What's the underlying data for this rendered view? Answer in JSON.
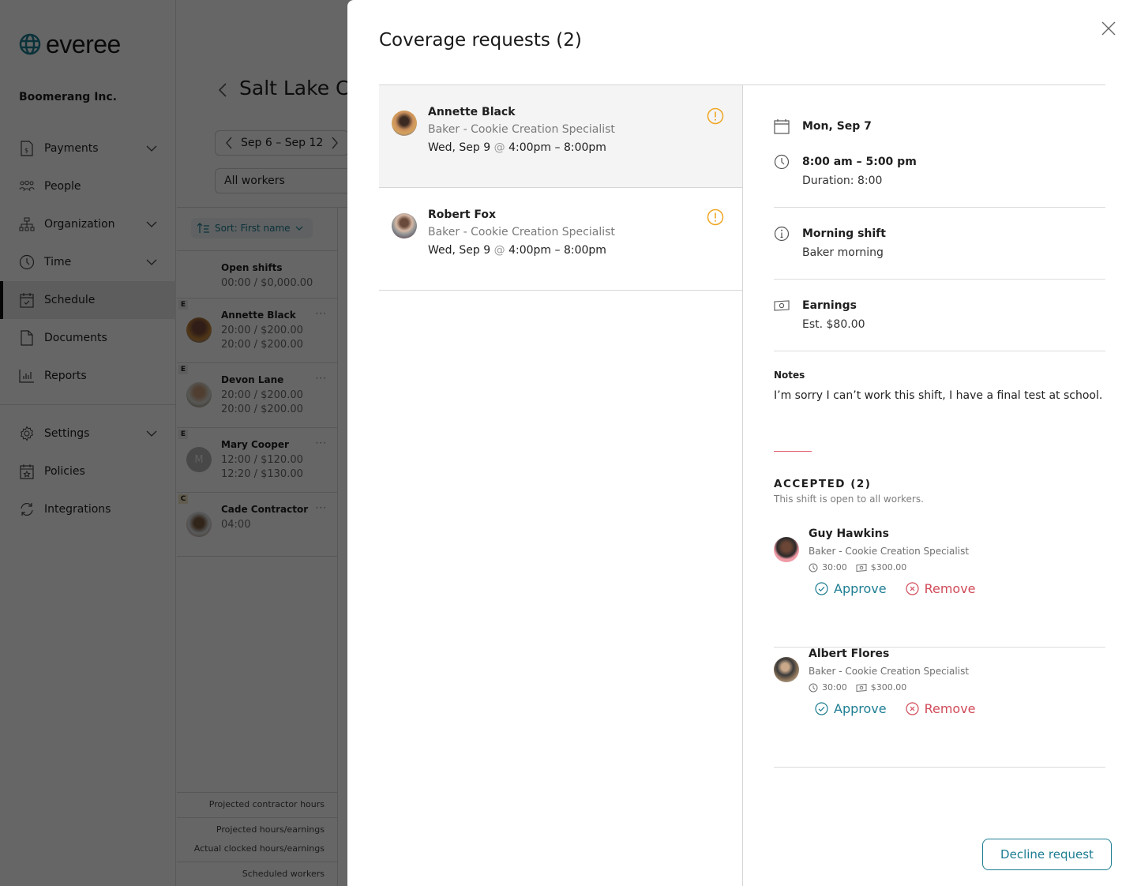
{
  "app": {
    "brand": "everee",
    "company": "Boomerang Inc.",
    "nav": [
      {
        "label": "Payments",
        "icon": "payments-icon",
        "expandable": true
      },
      {
        "label": "People",
        "icon": "people-icon",
        "expandable": false
      },
      {
        "label": "Organization",
        "icon": "organization-icon",
        "expandable": true
      },
      {
        "label": "Time",
        "icon": "clock-icon",
        "expandable": true
      },
      {
        "label": "Schedule",
        "icon": "calendar-check-icon",
        "expandable": false,
        "active": true
      },
      {
        "label": "Documents",
        "icon": "document-icon",
        "expandable": false
      },
      {
        "label": "Reports",
        "icon": "bar-chart-icon",
        "expandable": false
      }
    ],
    "nav_secondary": [
      {
        "label": "Settings",
        "icon": "gear-icon",
        "expandable": true
      },
      {
        "label": "Policies",
        "icon": "calendar-star-icon",
        "expandable": false
      },
      {
        "label": "Integrations",
        "icon": "sync-icon",
        "expandable": false
      }
    ],
    "page_title": "Salt Lake City",
    "date_range": "Sep 6 – Sep 12",
    "worker_filter": "All workers",
    "sort_label": "Sort: First name",
    "open_shifts": {
      "label": "Open shifts",
      "value": "00:00 / $0,000.00"
    },
    "schedule_rows": [
      {
        "type": "E",
        "name": "Annette Black",
        "lines": [
          "20:00 / $200.00",
          "20:00 / $200.00"
        ]
      },
      {
        "type": "E",
        "name": "Devon Lane",
        "lines": [
          "20:00 / $200.00",
          "20:00 / $200.00"
        ]
      },
      {
        "type": "E",
        "name": "Mary Cooper",
        "initial": "M",
        "lines": [
          "12:00 / $120.00",
          "12:20 / $130.00"
        ]
      },
      {
        "type": "C",
        "name": "Cade Contractor",
        "lines": [
          "04:00"
        ]
      }
    ],
    "footer_labels": {
      "contractor_hours": "Projected contractor hours",
      "projected": "Projected hours/earnings",
      "actual": "Actual clocked hours/earnings",
      "scheduled": "Scheduled workers"
    }
  },
  "modal": {
    "title": "Coverage requests (2)",
    "requests": [
      {
        "name": "Annette Black",
        "role": "Baker - Cookie Creation Specialist",
        "day": "Wed, Sep 9",
        "at": "@",
        "time": "4:00pm – 8:00pm",
        "selected": true
      },
      {
        "name": "Robert Fox",
        "role": "Baker - Cookie Creation Specialist",
        "day": "Wed, Sep 9",
        "at": "@",
        "time": "4:00pm – 8:00pm",
        "selected": false
      }
    ],
    "detail": {
      "date": "Mon, Sep 7",
      "time_range": "8:00 am – 5:00 pm",
      "duration": "Duration: 8:00",
      "shift_name": "Morning shift",
      "shift_desc": "Baker morning",
      "earnings_label": "Earnings",
      "earnings_value": "Est. $80.00",
      "notes_label": "Notes",
      "notes_text": "I’m sorry I can’t work this shift, I have a final test at school.",
      "accepted_title": "ACCEPTED (2)",
      "accepted_sub": "This shift is open to all workers.",
      "accepted": [
        {
          "name": "Guy Hawkins",
          "role": "Baker - Cookie Creation Specialist",
          "hours": "30:00",
          "pay": "$300.00"
        },
        {
          "name": "Albert Flores",
          "role": "Baker - Cookie Creation Specialist",
          "hours": "30:00",
          "pay": "$300.00"
        }
      ],
      "approve_label": "Approve",
      "remove_label": "Remove"
    },
    "decline_label": "Decline request"
  },
  "colors": {
    "accent": "#1d7d92",
    "danger": "#d04a58",
    "warning": "#f0a623"
  }
}
